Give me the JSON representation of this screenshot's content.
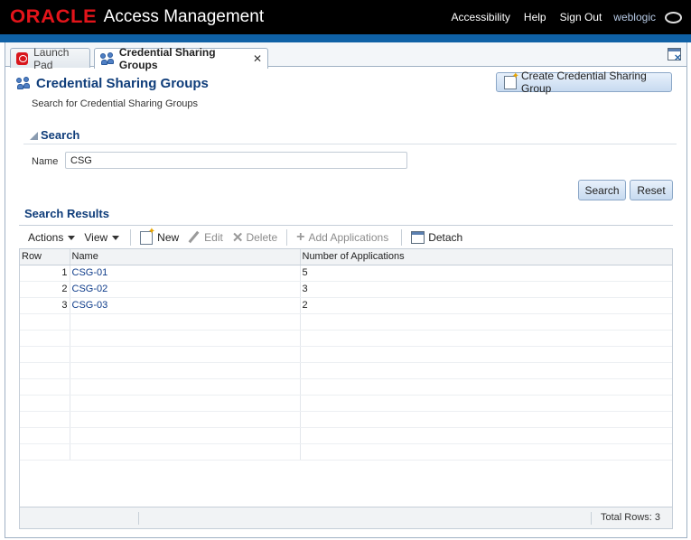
{
  "header": {
    "brand": "ORACLE",
    "app_title": "Access Management",
    "links": {
      "accessibility": "Accessibility",
      "help": "Help",
      "sign_out": "Sign Out"
    },
    "user": "weblogic"
  },
  "tabs": [
    {
      "label": "Launch Pad",
      "icon": "oracle-icon"
    },
    {
      "label": "Credential Sharing Groups",
      "icon": "people-icon",
      "close": "✕",
      "active": true
    }
  ],
  "page": {
    "title": "Credential Sharing Groups",
    "subtitle": "Search for Credential Sharing Groups",
    "create_button": "Create Credential Sharing Group"
  },
  "search": {
    "section_title": "Search",
    "name_label": "Name",
    "name_value": "CSG",
    "search_button": "Search",
    "reset_button": "Reset"
  },
  "results": {
    "title": "Search Results",
    "toolbar": {
      "actions": "Actions",
      "view": "View",
      "new": "New",
      "edit": "Edit",
      "delete": "Delete",
      "add_applications": "Add Applications",
      "detach": "Detach"
    },
    "columns": [
      "Row",
      "Name",
      "Number of Applications"
    ],
    "rows": [
      {
        "row": "1",
        "name": "CSG-01",
        "apps": "5"
      },
      {
        "row": "2",
        "name": "CSG-02",
        "apps": "3"
      },
      {
        "row": "3",
        "name": "CSG-03",
        "apps": "2"
      }
    ],
    "total_rows": "Total Rows: 3"
  },
  "colors": {
    "brand_red": "#e3141a",
    "header_bg": "#000000",
    "accent_blue": "#0f61a6",
    "title_blue": "#0f3d7a"
  }
}
